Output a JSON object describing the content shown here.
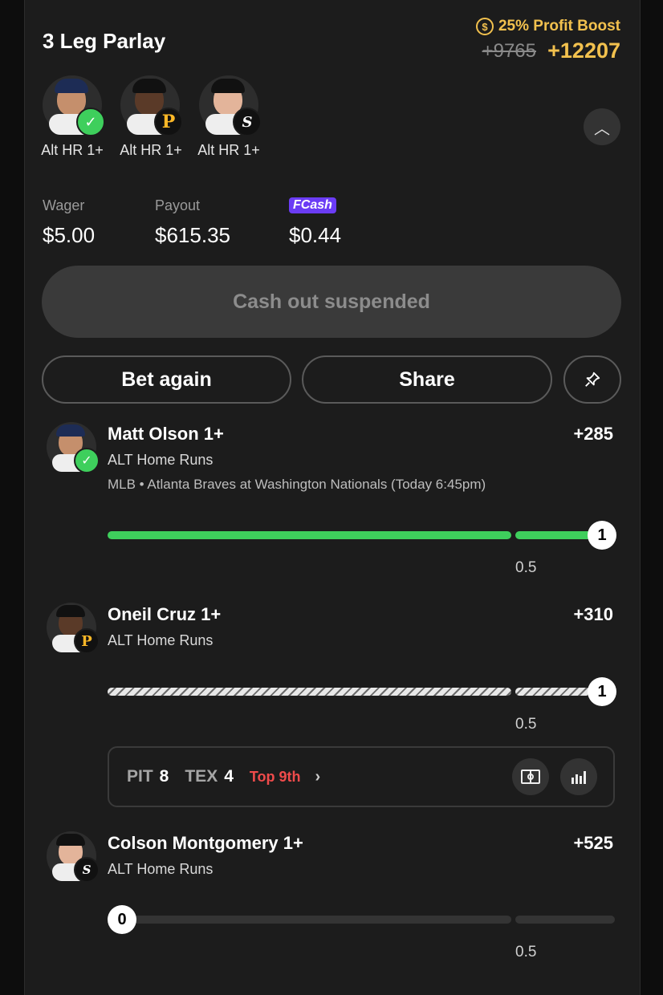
{
  "parlay": {
    "title": "3 Leg Parlay",
    "boost_label": "25% Profit Boost",
    "old_odds": "+9765",
    "new_odds": "+12207"
  },
  "legs": [
    {
      "label": "Alt HR 1+",
      "badge": "check"
    },
    {
      "label": "Alt HR 1+",
      "badge": "pirates"
    },
    {
      "label": "Alt HR 1+",
      "badge": "white-sox"
    }
  ],
  "stats": {
    "wager_label": "Wager",
    "wager_value": "$5.00",
    "payout_label": "Payout",
    "payout_value": "$615.35",
    "cash_label": "Cash",
    "cash_value": "$0.44"
  },
  "actions": {
    "cashout_label": "Cash out suspended",
    "bet_again_label": "Bet again",
    "share_label": "Share"
  },
  "picks": [
    {
      "player": "Matt Olson 1+",
      "odds": "+285",
      "market": "ALT Home Runs",
      "game": "MLB • Atlanta Braves at Washington Nationals (Today 6:45pm)",
      "progress": "1",
      "threshold": "0.5",
      "status": "won"
    },
    {
      "player": "Oneil Cruz 1+",
      "odds": "+310",
      "market": "ALT Home Runs",
      "progress": "1",
      "threshold": "0.5",
      "status": "pending"
    },
    {
      "player": "Colson Montgomery 1+",
      "odds": "+525",
      "market": "ALT Home Runs",
      "progress": "0",
      "threshold": "0.5",
      "status": "live"
    }
  ],
  "scoreboard": {
    "away_team": "PIT",
    "away_score": "8",
    "home_team": "TEX",
    "home_score": "4",
    "inning": "Top 9th"
  },
  "colors": {
    "accent_gold": "#f2c14e",
    "win_green": "#3ecf5c",
    "cash_purple": "#6b3cf5",
    "live_red": "#ef4b4b"
  }
}
